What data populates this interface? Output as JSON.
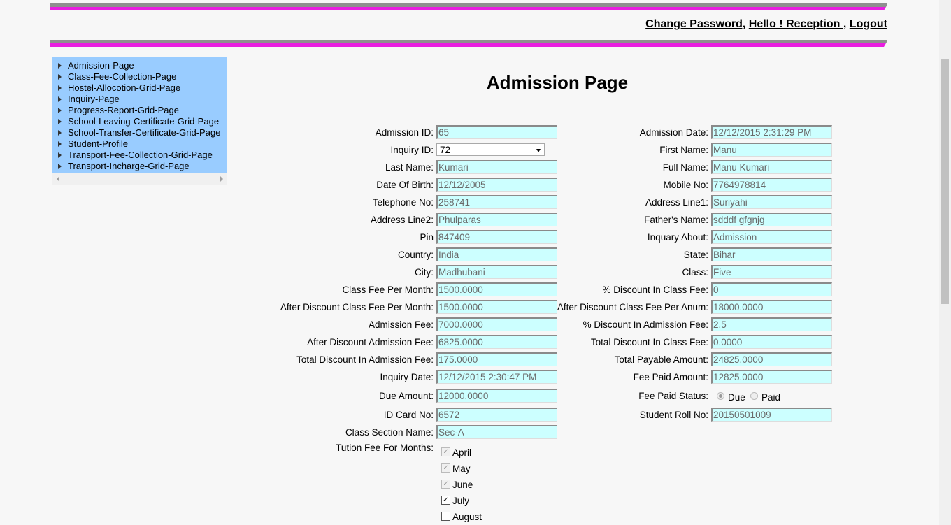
{
  "header": {
    "change_password": "Change Password,",
    "greeting": "Hello ! Reception ,",
    "logout": "Logout"
  },
  "sidebar": {
    "items": [
      "Admission-Page",
      "Class-Fee-Collection-Page",
      "Hostel-Allocotion-Grid-Page",
      "Inquiry-Page",
      "Progress-Report-Grid-Page",
      "School-Leaving-Certificate-Grid-Page",
      "School-Transfer-Certificate-Grid-Page",
      "Student-Profile",
      "Transport-Fee-Collection-Grid-Page",
      "Transport-Incharge-Grid-Page"
    ]
  },
  "page": {
    "title": "Admission Page"
  },
  "form": {
    "admission_id_label": "Admission ID:",
    "admission_id": "65",
    "admission_date_label": "Admission Date:",
    "admission_date": "12/12/2015 2:31:29 PM",
    "inquiry_id_label": "Inquiry ID:",
    "inquiry_id": "72",
    "first_name_label": "First Name:",
    "first_name": "Manu",
    "last_name_label": "Last Name:",
    "last_name": "Kumari",
    "full_name_label": "Full Name:",
    "full_name": "Manu Kumari",
    "dob_label": "Date Of Birth:",
    "dob": "12/12/2005",
    "mobile_label": "Mobile No:",
    "mobile": "7764978814",
    "telephone_label": "Telephone No:",
    "telephone": "258741",
    "address1_label": "Address Line1:",
    "address1": "Suriyahi",
    "address2_label": "Address Line2:",
    "address2": "Phulparas",
    "father_label": "Father's Name:",
    "father": "sdddf gfgnjg",
    "pin_label": "Pin",
    "pin": "847409",
    "inquiry_about_label": "Inquary About:",
    "inquiry_about": "Admission",
    "country_label": "Country:",
    "country": "India",
    "state_label": "State:",
    "state": "Bihar",
    "city_label": "City:",
    "city": "Madhubani",
    "class_label": "Class:",
    "class": "Five",
    "class_fee_label": "Class Fee Per Month:",
    "class_fee": "1500.0000",
    "disc_class_fee_label": "% Discount In Class Fee:",
    "disc_class_fee": "0",
    "after_disc_month_label": "After Discount Class Fee Per Month:",
    "after_disc_month": "1500.0000",
    "after_disc_anum_label": "After Discount Class Fee Per Anum:",
    "after_disc_anum": "18000.0000",
    "admission_fee_label": "Admission Fee:",
    "admission_fee": "7000.0000",
    "disc_admission_label": "% Discount In Admission Fee:",
    "disc_admission": "2.5",
    "after_disc_admission_label": "After Discount Admission Fee:",
    "after_disc_admission": "6825.0000",
    "total_disc_class_label": "Total Discount In Class Fee:",
    "total_disc_class": "0.0000",
    "total_disc_admission_label": "Total Discount In Admission Fee:",
    "total_disc_admission": "175.0000",
    "total_payable_label": "Total Payable Amount:",
    "total_payable": "24825.0000",
    "inquiry_date_label": "Inquiry Date:",
    "inquiry_date": "12/12/2015 2:30:47 PM",
    "fee_paid_label": "Fee Paid Amount:",
    "fee_paid": "12825.0000",
    "due_amount_label": "Due Amount:",
    "due_amount": "12000.0000",
    "fee_status_label": "Fee Paid Status:",
    "fee_status_due": "Due",
    "fee_status_paid": "Paid",
    "id_card_label": "ID Card No:",
    "id_card": "6572",
    "roll_no_label": "Student Roll No:",
    "roll_no": "20150501009",
    "section_label": "Class Section Name:",
    "section": "Sec-A",
    "tution_label": "Tution Fee For Months:",
    "months": [
      "April",
      "May",
      "June",
      "July",
      "August"
    ]
  }
}
